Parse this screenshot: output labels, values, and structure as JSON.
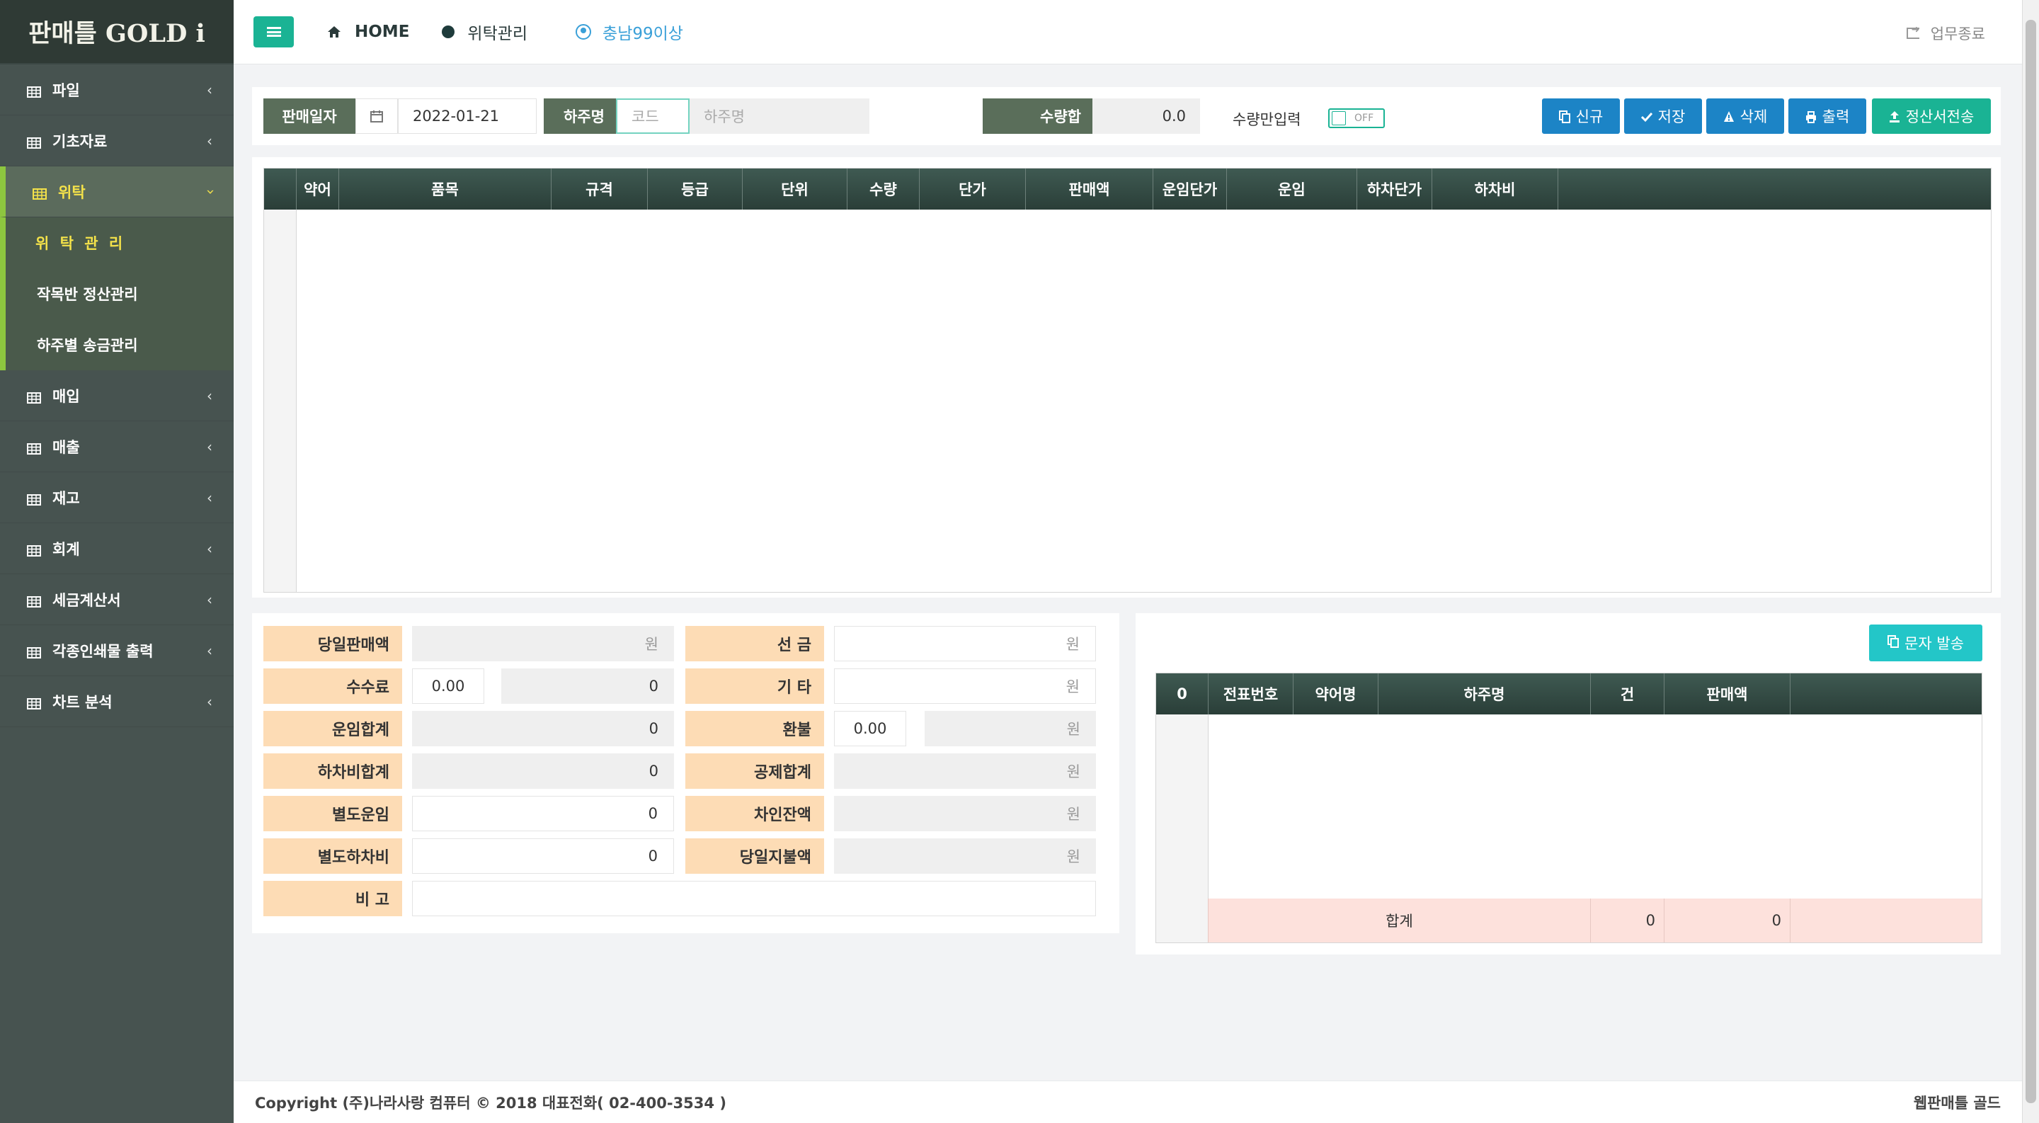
{
  "app": {
    "logo": "판매틀 GOLD i"
  },
  "sidebar": {
    "items": [
      {
        "label": "파일"
      },
      {
        "label": "기초자료"
      },
      {
        "label": "위탁",
        "active": true,
        "children": [
          {
            "label": "위 탁 관 리",
            "current": true
          },
          {
            "label": "작목반 정산관리"
          },
          {
            "label": "하주별 송금관리"
          }
        ]
      },
      {
        "label": "매입"
      },
      {
        "label": "매출"
      },
      {
        "label": "재고"
      },
      {
        "label": "회계"
      },
      {
        "label": "세금계산서"
      },
      {
        "label": "각종인쇄물 출력"
      },
      {
        "label": "차트 분석"
      }
    ]
  },
  "topbar": {
    "home": "HOME",
    "page": "위탁관리",
    "user": "충남99이상",
    "logout": "업무종료"
  },
  "filter": {
    "sale_date_label": "판매일자",
    "sale_date_value": "2022-01-21",
    "shipper_label": "하주명",
    "code_placeholder": "코드",
    "shipper_name_placeholder": "하주명",
    "qty_sum_label": "수량합",
    "qty_sum_value": "0.0",
    "qty_only_label": "수량만입력",
    "toggle_state": "OFF",
    "buttons": {
      "new": "신규",
      "save": "저장",
      "delete": "삭제",
      "print": "출력",
      "send": "정산서전송"
    }
  },
  "main_grid": {
    "columns": [
      "약어",
      "품목",
      "규격",
      "등급",
      "단위",
      "수량",
      "단가",
      "판매액",
      "운임단가",
      "운임",
      "하차단가",
      "하차비"
    ]
  },
  "summary": {
    "daily_sales_label": "당일판매액",
    "daily_sales_unit": "원",
    "advance_label": "선 금",
    "advance_unit": "원",
    "commission_label": "수수료",
    "commission_rate": "0.00",
    "commission_value": "0",
    "other_label": "기 타",
    "other_unit": "원",
    "freight_total_label": "운임합계",
    "freight_total_value": "0",
    "refund_label": "환불",
    "refund_rate": "0.00",
    "refund_unit": "원",
    "unload_total_label": "하차비합계",
    "unload_total_value": "0",
    "deduct_total_label": "공제합계",
    "deduct_total_unit": "원",
    "extra_freight_label": "별도운임",
    "extra_freight_value": "0",
    "balance_label": "차인잔액",
    "balance_unit": "원",
    "extra_unload_label": "별도하차비",
    "extra_unload_value": "0",
    "daily_paid_label": "당일지불액",
    "daily_paid_unit": "원",
    "memo_label": "비 고"
  },
  "sms": {
    "send_button": "문자 발송",
    "columns": [
      "0",
      "전표번호",
      "약어명",
      "하주명",
      "건",
      "판매액"
    ],
    "total_label": "합계",
    "total_count": "0",
    "total_sales": "0"
  },
  "footer": {
    "copyright": "Copyright (주)나라사랑 컴퓨터 © 2018 대표전화( 02-400-3534 )",
    "brand": "웹판매틀 골드"
  }
}
